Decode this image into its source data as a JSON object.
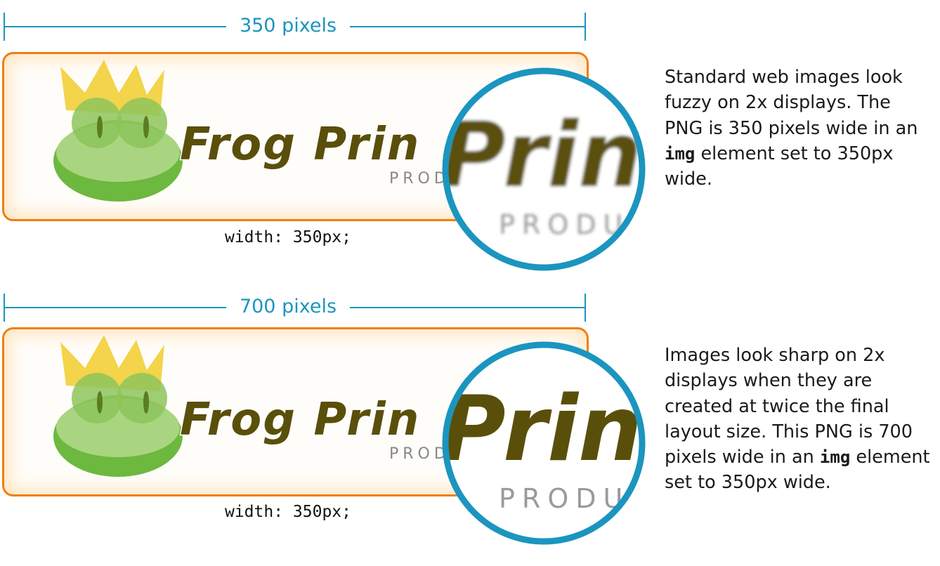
{
  "top": {
    "dimension_label": "350 pixels",
    "logo": {
      "main_text": "Frog Prin",
      "sub_text": "PROD"
    },
    "zoom": {
      "text": "Print",
      "sub_text": "PRODU",
      "quality": "fuzzy"
    },
    "code_caption": "width: 350px;",
    "description": {
      "part1": "Standard web images look fuzzy on 2x displays. The PNG is 350 pixels wide in an ",
      "code": "img",
      "part2": " element set to 350px wide."
    }
  },
  "bottom": {
    "dimension_label": "700 pixels",
    "logo": {
      "main_text": "Frog Prin",
      "sub_text": "PROD"
    },
    "zoom": {
      "text": "Print",
      "sub_text": "PRODU",
      "quality": "sharp"
    },
    "code_caption": "width: 350px;",
    "description": {
      "part1": "Images look sharp on 2x displays when they are created at twice the final layout size. This PNG is 700 pixels wide in an ",
      "code": "img",
      "part2": " element set to 350px wide."
    }
  },
  "colors": {
    "accent_blue": "#1b95bf",
    "border_orange": "#ee7f10",
    "text_olive": "#5a4f0a",
    "frog_green": "#7cc24a",
    "crown_yellow": "#f3d44a"
  }
}
